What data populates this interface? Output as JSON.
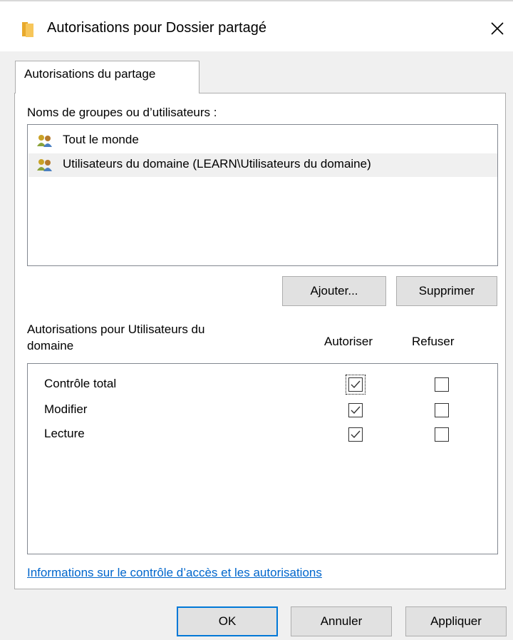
{
  "window": {
    "title": "Autorisations pour Dossier partagé",
    "close_glyph": "✕"
  },
  "tabs": [
    {
      "label": "Autorisations du partage",
      "selected": true
    }
  ],
  "groups": {
    "label": "Noms de groupes ou d’utilisateurs :",
    "items": [
      {
        "name": "Tout le monde",
        "icon": "users-icon",
        "selected": false
      },
      {
        "name": "Utilisateurs du domaine (LEARN\\Utilisateurs du domaine)",
        "icon": "users-icon",
        "selected": true
      }
    ],
    "add_label": "Ajouter...",
    "remove_label": "Supprimer"
  },
  "permissions": {
    "label_line1": "Autorisations pour Utilisateurs du",
    "label_line2": "domaine",
    "allow_header": "Autoriser",
    "deny_header": "Refuser",
    "rows": [
      {
        "name": "Contrôle total",
        "allow": true,
        "deny": false
      },
      {
        "name": "Modifier",
        "allow": true,
        "deny": false
      },
      {
        "name": "Lecture",
        "allow": true,
        "deny": false
      }
    ]
  },
  "link": "Informations sur le contrôle d’accès et les autorisations",
  "footer": {
    "ok_label": "OK",
    "cancel_label": "Annuler",
    "apply_label": "Appliquer"
  },
  "colors": {
    "accent": "#0078d7",
    "link": "#0066cc",
    "folder": "#f7c65a"
  }
}
